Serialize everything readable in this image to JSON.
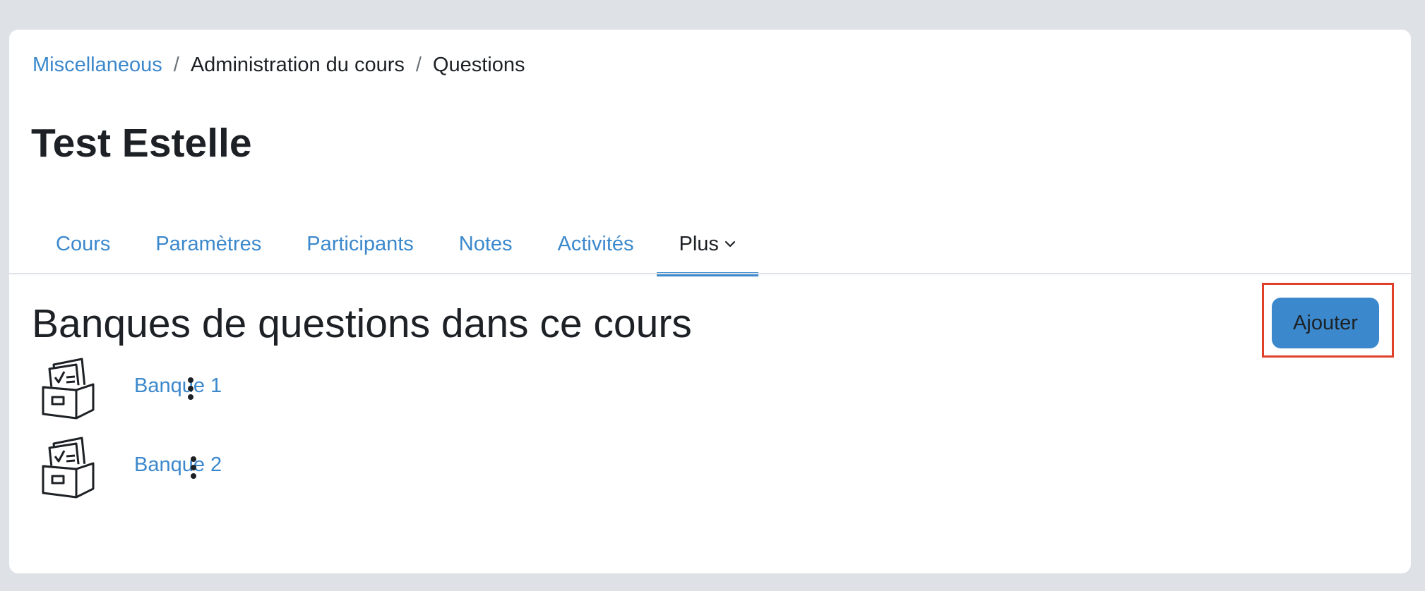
{
  "breadcrumb": {
    "items": [
      {
        "label": "Miscellaneous"
      },
      {
        "label": "Administration du cours"
      },
      {
        "label": "Questions"
      }
    ],
    "separator": "/"
  },
  "page_title": "Test Estelle",
  "tabs": [
    {
      "label": "Cours"
    },
    {
      "label": "Paramètres"
    },
    {
      "label": "Participants"
    },
    {
      "label": "Notes"
    },
    {
      "label": "Activités"
    },
    {
      "label": "Plus"
    }
  ],
  "active_tab": "Plus",
  "section": {
    "title": "Banques de questions dans ce cours",
    "add_label": "Ajouter"
  },
  "banks": [
    {
      "label": "Banque 1",
      "icon": "question-bank-icon"
    },
    {
      "label": "Banque 2",
      "icon": "question-bank-icon"
    }
  ],
  "colors": {
    "accent": "#3b88cc",
    "text": "#1d2125",
    "background": "#dee2e6",
    "highlight": "#e0402a"
  }
}
